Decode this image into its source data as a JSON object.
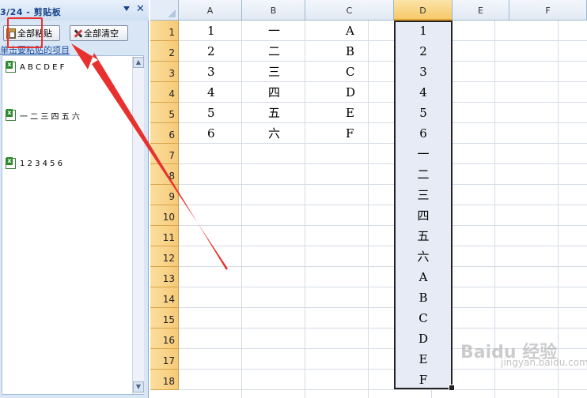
{
  "clipboard": {
    "title": "3/24 - 剪贴板",
    "paste_all": "全部粘贴",
    "clear_all": "全部清空",
    "hint": "单击要粘贴的项目",
    "items": [
      "A B C D E F",
      "一 二 三 四 五 六",
      "1 2 3 4 5 6"
    ]
  },
  "sheet": {
    "columns": [
      "A",
      "B",
      "C",
      "D",
      "E",
      "F"
    ],
    "selected_column": "D",
    "rows": [
      "1",
      "2",
      "3",
      "4",
      "5",
      "6",
      "7",
      "8",
      "9",
      "10",
      "11",
      "12",
      "13",
      "14",
      "15",
      "16",
      "17",
      "18"
    ],
    "col_a": [
      "1",
      "2",
      "3",
      "4",
      "5",
      "6"
    ],
    "col_b": [
      "一",
      "二",
      "三",
      "四",
      "五",
      "六"
    ],
    "col_c": [
      "A",
      "B",
      "C",
      "D",
      "E",
      "F"
    ],
    "col_d": [
      "1",
      "2",
      "3",
      "4",
      "5",
      "6",
      "一",
      "二",
      "三",
      "四",
      "五",
      "六",
      "A",
      "B",
      "C",
      "D",
      "E",
      "F"
    ]
  },
  "watermark": {
    "text": "Baidu 经验",
    "sub": "jingyan.baidu.com"
  },
  "colors": {
    "annotation": "#e8312f",
    "selected_header": "#f6c96a",
    "pane": "#d9e6f5"
  }
}
